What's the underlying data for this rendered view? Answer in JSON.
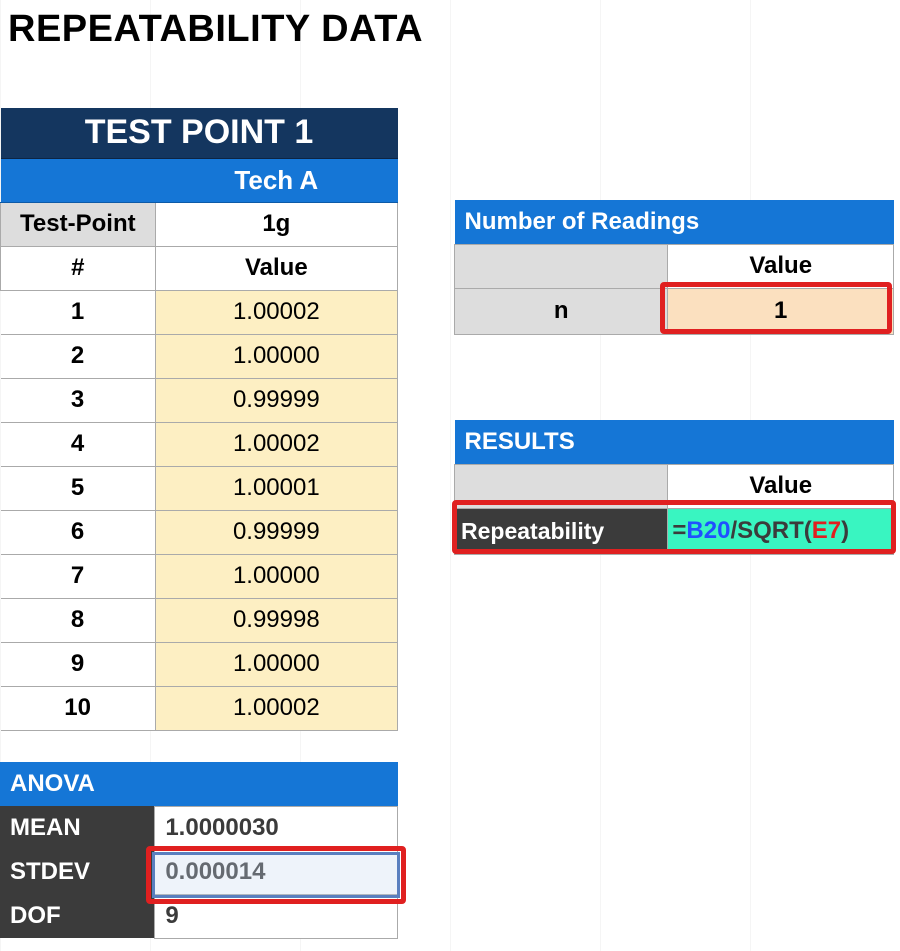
{
  "title": "REPEATABILITY DATA",
  "test_point": {
    "header": "TEST POINT 1",
    "tech": "Tech A",
    "tp_label": "Test-Point",
    "tp_value": "1g",
    "num_header": "#",
    "val_header": "Value",
    "rows": [
      {
        "n": "1",
        "v": "1.00002"
      },
      {
        "n": "2",
        "v": "1.00000"
      },
      {
        "n": "3",
        "v": "0.99999"
      },
      {
        "n": "4",
        "v": "1.00002"
      },
      {
        "n": "5",
        "v": "1.00001"
      },
      {
        "n": "6",
        "v": "0.99999"
      },
      {
        "n": "7",
        "v": "1.00000"
      },
      {
        "n": "8",
        "v": "0.99998"
      },
      {
        "n": "9",
        "v": "1.00000"
      },
      {
        "n": "10",
        "v": "1.00002"
      }
    ]
  },
  "anova": {
    "header": "ANOVA",
    "mean_label": "MEAN",
    "mean_value": "1.0000030",
    "stdev_label": "STDEV",
    "stdev_value": "0.000014",
    "dof_label": "DOF",
    "dof_value": "9"
  },
  "readings": {
    "header": "Number of Readings",
    "val_header": "Value",
    "n_label": "n",
    "n_value": "1"
  },
  "results": {
    "header": "RESULTS",
    "val_header": "Value",
    "rep_label": "Repeatability",
    "formula_eq": "=",
    "formula_ref1": "B20",
    "formula_slash": "/SQRT(",
    "formula_ref2": "E7",
    "formula_close": ")"
  }
}
